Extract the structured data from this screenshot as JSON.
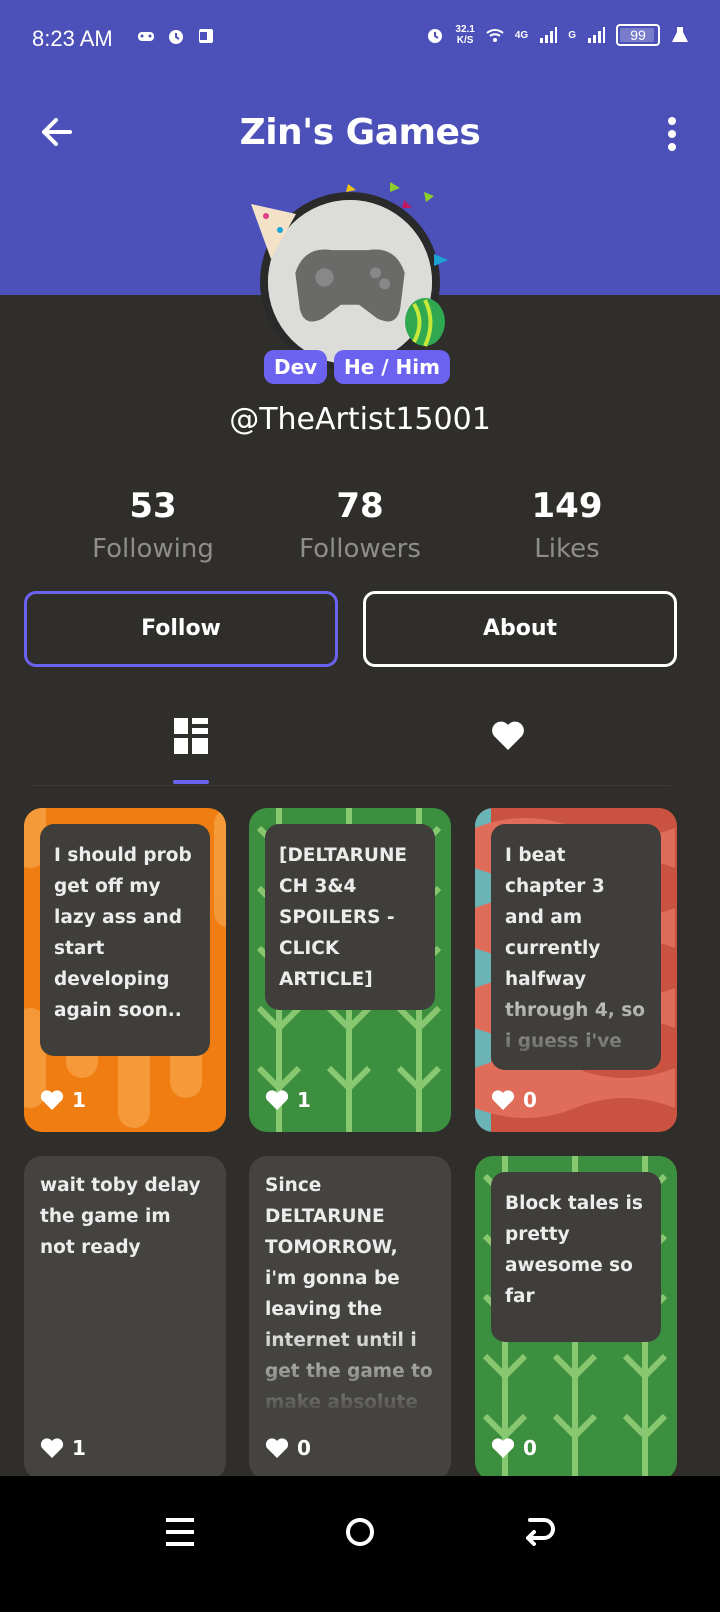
{
  "status_bar": {
    "time": "8:23 AM",
    "speed_value": "32.1",
    "speed_unit": "K/S",
    "network_1": "4G",
    "network_2": "G",
    "battery": "99"
  },
  "header": {
    "title": "Zin's Games"
  },
  "profile": {
    "badges": [
      "Dev",
      "He / Him"
    ],
    "username": "@TheArtist15001"
  },
  "stats": [
    {
      "value": "53",
      "label": "Following"
    },
    {
      "value": "78",
      "label": "Followers"
    },
    {
      "value": "149",
      "label": "Likes"
    }
  ],
  "actions": {
    "follow_label": "Follow",
    "about_label": "About"
  },
  "tabs": [
    {
      "icon": "grid-icon",
      "active": true
    },
    {
      "icon": "heart-icon",
      "active": false
    }
  ],
  "posts": [
    {
      "text": "I should prob get off my lazy ass and start developing again soon..",
      "likes": "1",
      "background": "orange-pattern"
    },
    {
      "text": "[DELTARUNE CH 3&4 SPOILERS - CLICK ARTICLE]",
      "likes": "1",
      "background": "green-leaves"
    },
    {
      "text": "I beat chapter 3 and am currently halfway through 4, so i guess i've",
      "likes": "0",
      "background": "red-waves"
    },
    {
      "text": "wait toby delay the game im not ready",
      "likes": "1",
      "background": "plain"
    },
    {
      "text": "Since DELTARUNE TOMORROW, i'm gonna be leaving the internet until i get the game to make absolute",
      "likes": "0",
      "background": "plain"
    },
    {
      "text": "Block tales is pretty awesome so far",
      "likes": "0",
      "background": "green-leaves"
    }
  ],
  "colors": {
    "header": "#4c50b9",
    "accent": "#6b63f0",
    "background": "#2f2e2b"
  }
}
